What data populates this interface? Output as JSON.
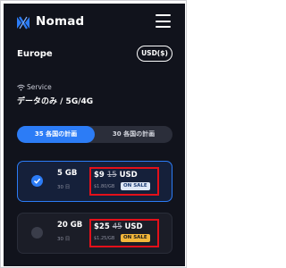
{
  "app": {
    "brand": "Nomad"
  },
  "header": {
    "region": "Europe",
    "currency_label": "USD($)"
  },
  "service": {
    "label": "Service",
    "value": "データのみ / 5G/4G"
  },
  "tabs": [
    {
      "label": "35 各国の計画",
      "active": true
    },
    {
      "label": "30 各国の計画",
      "active": false
    }
  ],
  "plans": [
    {
      "data": "5 GB",
      "days": "30 日",
      "price": "$9",
      "original_price": "15",
      "currency": "USD",
      "per_gb": "$1.80/GB",
      "badge": "ON SALE",
      "selected": true
    },
    {
      "data": "20 GB",
      "days": "30 日",
      "price": "$25",
      "original_price": "45",
      "currency": "USD",
      "per_gb": "$1.25/GB",
      "badge": "ON SALE",
      "selected": false
    }
  ],
  "colors": {
    "accent": "#2c7cf6",
    "background": "#11131c",
    "highlight_box": "#e3101a",
    "sale_yellow": "#f4b73a"
  },
  "icons": {
    "logo": "nomad-logo-icon",
    "menu": "hamburger-menu-icon",
    "wifi": "wifi-icon",
    "check": "check-icon"
  }
}
